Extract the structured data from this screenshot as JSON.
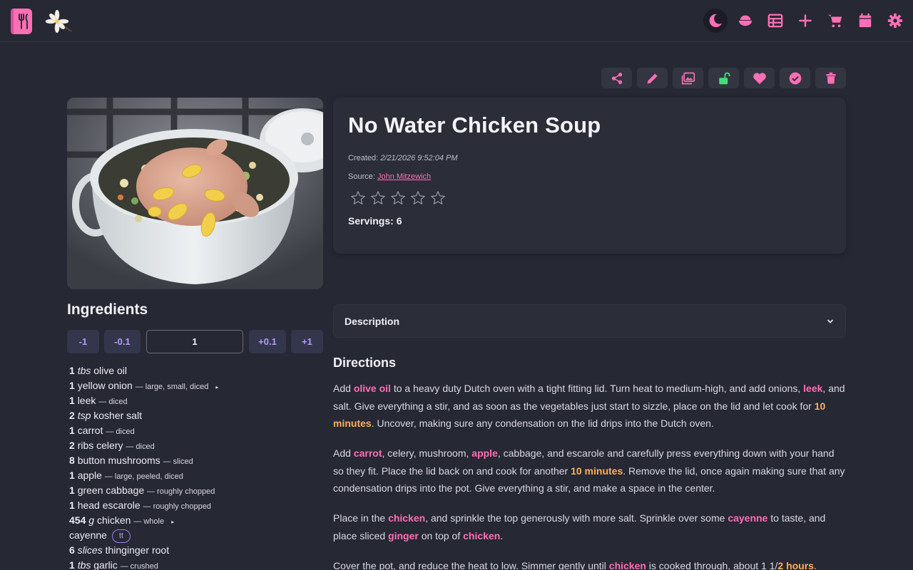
{
  "header": {
    "nav": [
      {
        "name": "theme-toggle",
        "icon": "moon-icon"
      },
      {
        "name": "recipes",
        "icon": "bowl-icon"
      },
      {
        "name": "list",
        "icon": "table-icon"
      },
      {
        "name": "add",
        "icon": "plus-icon"
      },
      {
        "name": "shopping",
        "icon": "cart-icon"
      },
      {
        "name": "calendar",
        "icon": "calendar-icon"
      },
      {
        "name": "settings",
        "icon": "gear-icon"
      }
    ]
  },
  "actions": [
    "share-icon",
    "edit-icon",
    "images-icon",
    "unlock-icon",
    "heart-icon",
    "check-icon",
    "trash-icon"
  ],
  "recipe": {
    "title": "No Water Chicken Soup",
    "created_label": "Created:",
    "created_value": "2/21/2026 9:52:04 PM",
    "source_label": "Source:",
    "source_value": "John Mitzewich",
    "rating": 0,
    "rating_max": 5,
    "servings": "Servings: 6"
  },
  "ingredients": {
    "title": "Ingredients",
    "scaler": {
      "minus1": "-1",
      "minus01": "-0.1",
      "value": "1",
      "plus01": "+0.1",
      "plus1": "+1"
    },
    "items": [
      {
        "qty": "1",
        "unit": "tbs",
        "name": "olive oil",
        "note": "",
        "expand": false
      },
      {
        "qty": "1",
        "unit": "",
        "name": "yellow onion",
        "note": "— large, small, diced",
        "expand": true
      },
      {
        "qty": "1",
        "unit": "",
        "name": "leek",
        "note": "— diced",
        "expand": false
      },
      {
        "qty": "2",
        "unit": "tsp",
        "name": "kosher salt",
        "note": "",
        "expand": false
      },
      {
        "qty": "1",
        "unit": "",
        "name": "carrot",
        "note": "— diced",
        "expand": false
      },
      {
        "qty": "2",
        "unit": "",
        "name": "ribs celery",
        "note": "— diced",
        "expand": false
      },
      {
        "qty": "8",
        "unit": "",
        "name": "button mushrooms",
        "note": "— sliced",
        "expand": false
      },
      {
        "qty": "1",
        "unit": "",
        "name": "apple",
        "note": "— large, peeled, diced",
        "expand": false
      },
      {
        "qty": "1",
        "unit": "",
        "name": "green cabbage",
        "note": "— roughly chopped",
        "expand": false
      },
      {
        "qty": "1",
        "unit": "",
        "name": "head escarole",
        "note": "— roughly chopped",
        "expand": false
      },
      {
        "qty": "454",
        "unit": "g",
        "name": "chicken",
        "note": "— whole",
        "expand": true
      },
      {
        "qty": "",
        "unit": "",
        "name": "cayenne",
        "note": "",
        "expand": false,
        "badge": "tt"
      },
      {
        "qty": "6",
        "unit": "slices",
        "name": "thinginger root",
        "note": "",
        "expand": false
      },
      {
        "qty": "1",
        "unit": "tbs",
        "name": "garlic",
        "note": "— crushed",
        "expand": false
      }
    ]
  },
  "description": {
    "label": "Description"
  },
  "directions": {
    "title": "Directions",
    "paragraphs": [
      [
        {
          "t": "Add "
        },
        {
          "t": "olive oil",
          "k": "pk"
        },
        {
          "t": " to a heavy duty Dutch oven with a tight fitting lid. Turn heat to medium-high, and add onions, "
        },
        {
          "t": "leek",
          "k": "pk"
        },
        {
          "t": ", and salt. Give everything a stir, and as soon as the vegetables just start to sizzle, place on the lid and let cook for "
        },
        {
          "t": "10 minutes",
          "k": "tm"
        },
        {
          "t": ". Uncover, making sure any condensation on the lid drips into the Dutch oven."
        }
      ],
      [
        {
          "t": "Add "
        },
        {
          "t": "carrot",
          "k": "pk"
        },
        {
          "t": ", celery, mushroom, "
        },
        {
          "t": "apple",
          "k": "pk"
        },
        {
          "t": ", cabbage, and escarole and carefully press everything down with your hand so they fit. Place the lid back on and cook for another "
        },
        {
          "t": "10 minutes",
          "k": "tm"
        },
        {
          "t": ". Remove the lid, once again making sure that any condensation drips into the pot. Give everything a stir, and make a space in the center."
        }
      ],
      [
        {
          "t": "Place in the "
        },
        {
          "t": "chicken",
          "k": "pk"
        },
        {
          "t": ", and sprinkle the top generously with more salt. Sprinkle over some "
        },
        {
          "t": "cayenne",
          "k": "pk"
        },
        {
          "t": " to taste, and place sliced "
        },
        {
          "t": "ginger",
          "k": "pk"
        },
        {
          "t": " on top of "
        },
        {
          "t": "chicken",
          "k": "pk"
        },
        {
          "t": "."
        }
      ],
      [
        {
          "t": "Cover the pot, and reduce the heat to low. Simmer gently until "
        },
        {
          "t": "chicken",
          "k": "pk"
        },
        {
          "t": " is cooked through, about 1 1/"
        },
        {
          "t": "2 hours",
          "k": "tm"
        },
        {
          "t": "."
        }
      ]
    ]
  },
  "colors": {
    "accent": "#ff6fb5",
    "time": "#ffb05a",
    "unlock": "#3fe07a",
    "scaler_text": "#b69cf8",
    "bg": "#262834"
  }
}
